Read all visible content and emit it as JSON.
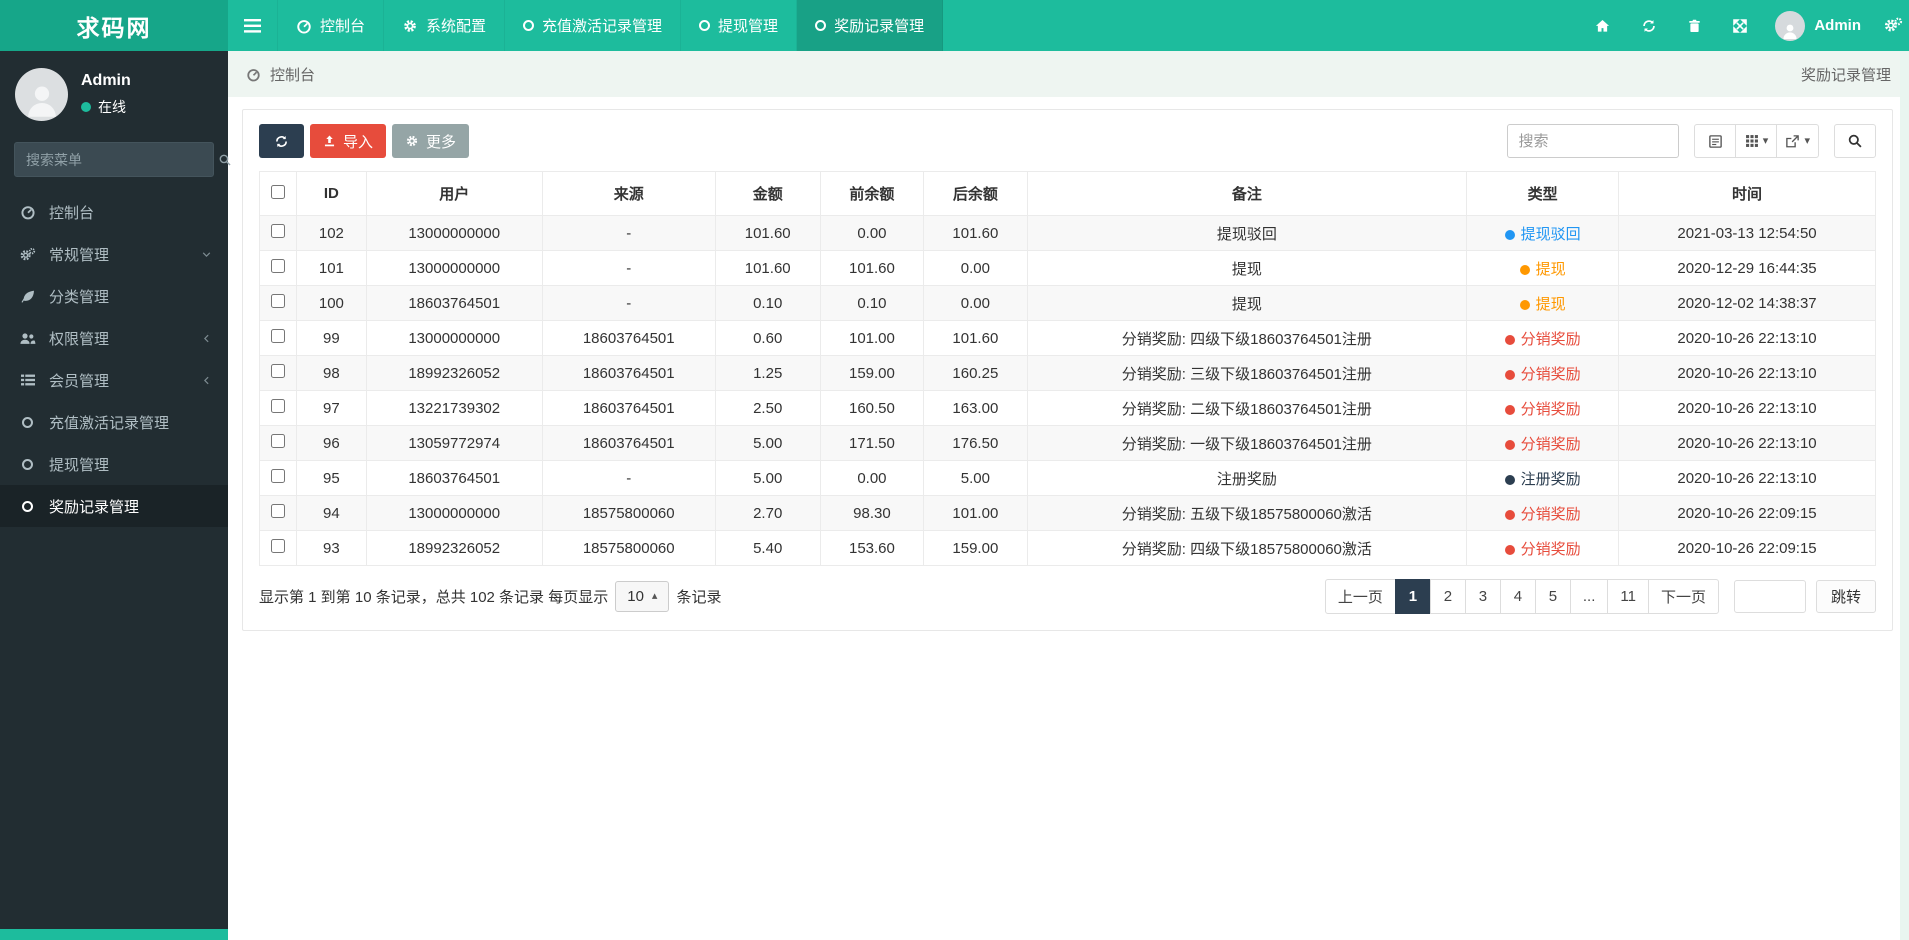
{
  "brand": "求码网",
  "navbar": {
    "items": [
      {
        "label": "控制台",
        "icon": "gauge-icon",
        "active": false
      },
      {
        "label": "系统配置",
        "icon": "gear-icon",
        "active": false
      },
      {
        "label": "充值激活记录管理",
        "icon": "circle-icon",
        "active": false
      },
      {
        "label": "提现管理",
        "icon": "circle-icon",
        "active": false
      },
      {
        "label": "奖励记录管理",
        "icon": "circle-icon",
        "active": true
      }
    ],
    "user_name": "Admin"
  },
  "sidebar": {
    "profile": {
      "name": "Admin",
      "status": "在线"
    },
    "search_placeholder": "搜索菜单",
    "items": [
      {
        "label": "控制台",
        "icon": "gauge-icon"
      },
      {
        "label": "常规管理",
        "icon": "cogs-icon",
        "chevron": "down"
      },
      {
        "label": "分类管理",
        "icon": "leaf-icon"
      },
      {
        "label": "权限管理",
        "icon": "users-icon",
        "chevron": "left"
      },
      {
        "label": "会员管理",
        "icon": "list-icon",
        "chevron": "left"
      },
      {
        "label": "充值激活记录管理",
        "icon": "circle-icon"
      },
      {
        "label": "提现管理",
        "icon": "circle-icon"
      },
      {
        "label": "奖励记录管理",
        "icon": "circle-icon",
        "active": true
      }
    ]
  },
  "breadcrumb": {
    "left": "控制台",
    "right": "奖励记录管理"
  },
  "toolbar": {
    "import_label": "导入",
    "more_label": "更多",
    "search_placeholder": "搜索"
  },
  "table": {
    "columns": [
      "ID",
      "用户",
      "来源",
      "金额",
      "前余额",
      "后余额",
      "备注",
      "类型",
      "时间"
    ],
    "rows": [
      {
        "id": "102",
        "user": "13000000000",
        "source": "-",
        "amount": "101.60",
        "before": "0.00",
        "after": "101.60",
        "remark": "提现驳回",
        "type": "提现驳回",
        "type_color": "#2196f3",
        "time": "2021-03-13 12:54:50"
      },
      {
        "id": "101",
        "user": "13000000000",
        "source": "-",
        "amount": "101.60",
        "before": "101.60",
        "after": "0.00",
        "remark": "提现",
        "type": "提现",
        "type_color": "#ff9800",
        "time": "2020-12-29 16:44:35"
      },
      {
        "id": "100",
        "user": "18603764501",
        "source": "-",
        "amount": "0.10",
        "before": "0.10",
        "after": "0.00",
        "remark": "提现",
        "type": "提现",
        "type_color": "#ff9800",
        "time": "2020-12-02 14:38:37"
      },
      {
        "id": "99",
        "user": "13000000000",
        "source": "18603764501",
        "amount": "0.60",
        "before": "101.00",
        "after": "101.60",
        "remark": "分销奖励: 四级下级18603764501注册",
        "type": "分销奖励",
        "type_color": "#e74c3c",
        "time": "2020-10-26 22:13:10"
      },
      {
        "id": "98",
        "user": "18992326052",
        "source": "18603764501",
        "amount": "1.25",
        "before": "159.00",
        "after": "160.25",
        "remark": "分销奖励: 三级下级18603764501注册",
        "type": "分销奖励",
        "type_color": "#e74c3c",
        "time": "2020-10-26 22:13:10"
      },
      {
        "id": "97",
        "user": "13221739302",
        "source": "18603764501",
        "amount": "2.50",
        "before": "160.50",
        "after": "163.00",
        "remark": "分销奖励: 二级下级18603764501注册",
        "type": "分销奖励",
        "type_color": "#e74c3c",
        "time": "2020-10-26 22:13:10"
      },
      {
        "id": "96",
        "user": "13059772974",
        "source": "18603764501",
        "amount": "5.00",
        "before": "171.50",
        "after": "176.50",
        "remark": "分销奖励: 一级下级18603764501注册",
        "type": "分销奖励",
        "type_color": "#e74c3c",
        "time": "2020-10-26 22:13:10"
      },
      {
        "id": "95",
        "user": "18603764501",
        "source": "-",
        "amount": "5.00",
        "before": "0.00",
        "after": "5.00",
        "remark": "注册奖励",
        "type": "注册奖励",
        "type_color": "#2c3e50",
        "time": "2020-10-26 22:13:10"
      },
      {
        "id": "94",
        "user": "13000000000",
        "source": "18575800060",
        "amount": "2.70",
        "before": "98.30",
        "after": "101.00",
        "remark": "分销奖励: 五级下级18575800060激活",
        "type": "分销奖励",
        "type_color": "#e74c3c",
        "time": "2020-10-26 22:09:15"
      },
      {
        "id": "93",
        "user": "18992326052",
        "source": "18575800060",
        "amount": "5.40",
        "before": "153.60",
        "after": "159.00",
        "remark": "分销奖励: 四级下级18575800060激活",
        "type": "分销奖励",
        "type_color": "#e74c3c",
        "time": "2020-10-26 22:09:15"
      }
    ]
  },
  "pagination": {
    "summary_prefix": "显示第 1 到第 10 条记录，总共 102 条记录 每页显示",
    "page_size": "10",
    "summary_suffix": "条记录",
    "pages": [
      "上一页",
      "1",
      "2",
      "3",
      "4",
      "5",
      "...",
      "11",
      "下一页"
    ],
    "active": "1",
    "jump_label": "跳转"
  },
  "colors": {
    "primary_teal": "#1dbc9d",
    "brand_teal": "#16a689",
    "dark_navy": "#2c3e50",
    "danger_red": "#e74c3c",
    "muted_gray": "#95a5a6",
    "type_blue": "#2196f3",
    "type_orange": "#ff9800",
    "type_red": "#e74c3c",
    "type_navy": "#2c3e50"
  }
}
